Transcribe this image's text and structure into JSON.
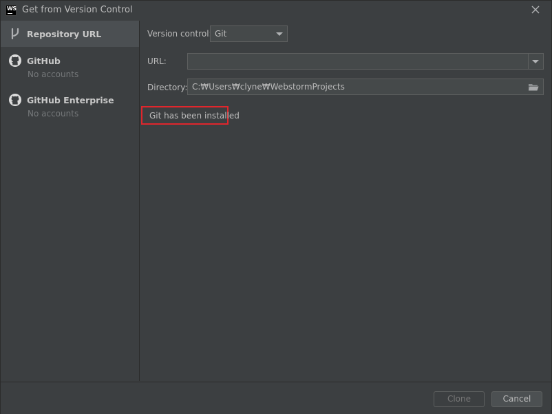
{
  "window": {
    "title": "Get from Version Control",
    "logo_text": "WS"
  },
  "sidebar": {
    "items": [
      {
        "label": "Repository URL",
        "icon": "vcs-branch-icon",
        "selected": true,
        "sub": ""
      },
      {
        "label": "GitHub",
        "icon": "github-icon",
        "selected": false,
        "sub": "No accounts"
      },
      {
        "label": "GitHub Enterprise",
        "icon": "github-icon",
        "selected": false,
        "sub": "No accounts"
      }
    ]
  },
  "form": {
    "vcs_label": "Version control:",
    "vcs_value": "Git",
    "url_label": "URL:",
    "url_value": "",
    "directory_label": "Directory:",
    "directory_value": "C:₩Users₩clyne₩WebstormProjects",
    "status_message": "Git has been installed"
  },
  "footer": {
    "clone_label": "Clone",
    "cancel_label": "Cancel"
  },
  "colors": {
    "background": "#3c3f41",
    "selection": "#4b4f52",
    "field_bg": "#45494a",
    "border": "#5e6060",
    "highlight_box": "#e0262c",
    "text": "#bbbbbb",
    "muted_text": "#75787a"
  }
}
